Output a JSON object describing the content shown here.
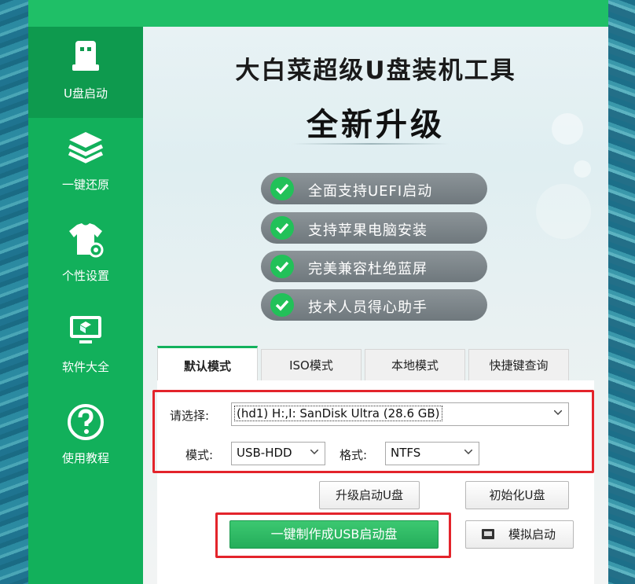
{
  "sidebar": {
    "items": [
      {
        "label": "U盘启动",
        "icon": "usb-drive-icon",
        "active": true
      },
      {
        "label": "一键还原",
        "icon": "layers-icon",
        "active": false
      },
      {
        "label": "个性设置",
        "icon": "shirt-gear-icon",
        "active": false
      },
      {
        "label": "软件大全",
        "icon": "monitor-box-icon",
        "active": false
      },
      {
        "label": "使用教程",
        "icon": "help-icon",
        "active": false
      }
    ]
  },
  "header": {
    "title": "大白菜超级U盘装机工具",
    "subtitle": "全新升级"
  },
  "features": [
    "全面支持UEFI启动",
    "支持苹果电脑安装",
    "完美兼容杜绝蓝屏",
    "技术人员得心助手"
  ],
  "tabs": [
    "默认模式",
    "ISO模式",
    "本地模式",
    "快捷键查询"
  ],
  "form": {
    "select_label": "请选择:",
    "device_value": "(hd1) H:,I: SanDisk Ultra (28.6 GB)",
    "mode_label": "模式:",
    "mode_value": "USB-HDD",
    "format_label": "格式:",
    "format_value": "NTFS"
  },
  "buttons": {
    "upgrade": "升级启动U盘",
    "initialize": "初始化U盘",
    "make": "一键制作成USB启动盘",
    "simulate": "模拟启动"
  },
  "colors": {
    "brand_green": "#13b25d",
    "highlight_red": "#e3242b"
  }
}
